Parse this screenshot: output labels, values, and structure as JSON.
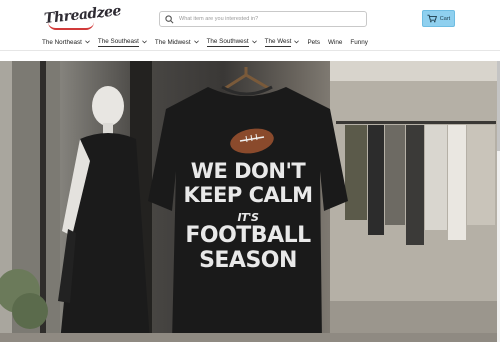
{
  "header": {
    "logo_alt": "Threadzee",
    "search_placeholder": "What item are you interested in?",
    "cart_label": "Cart"
  },
  "nav": {
    "items": [
      {
        "label": "The Northeast",
        "dropdown": true,
        "active": false
      },
      {
        "label": "The Southeast",
        "dropdown": true,
        "active": true
      },
      {
        "label": "The Midwest",
        "dropdown": true,
        "active": false
      },
      {
        "label": "The Southwest",
        "dropdown": true,
        "active": true
      },
      {
        "label": "The West",
        "dropdown": true,
        "active": true
      },
      {
        "label": "Pets",
        "dropdown": false,
        "active": false
      },
      {
        "label": "Wine",
        "dropdown": false,
        "active": false
      },
      {
        "label": "Funny",
        "dropdown": false,
        "active": false
      }
    ]
  },
  "hero": {
    "shirt_lines": [
      "WE DON'T",
      "KEEP CALM",
      "IT'S",
      "FOOTBALL",
      "SEASON"
    ]
  },
  "colors": {
    "cart_bg": "#8fd0ef",
    "logo_red": "#d13a3a",
    "shirt_black": "#1a1a1a"
  }
}
